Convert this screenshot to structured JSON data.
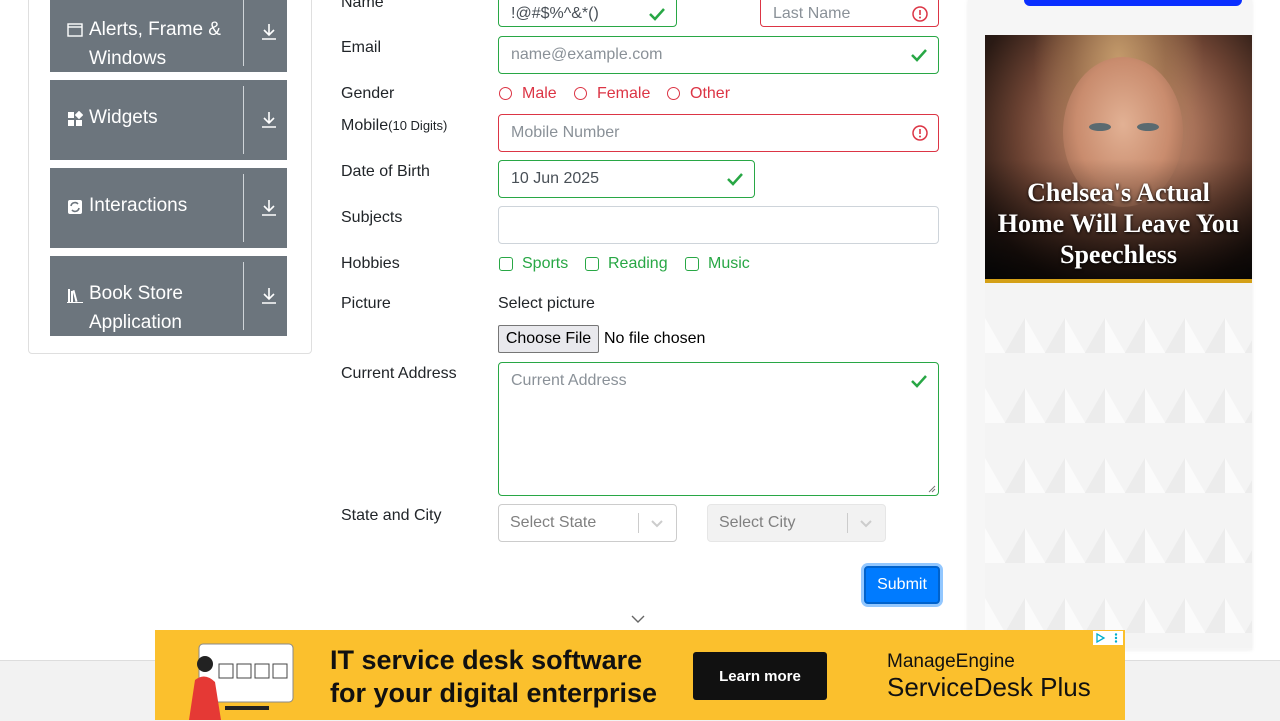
{
  "sidebar": {
    "groups": [
      {
        "label": "Alerts, Frame & Windows",
        "icon": "window-icon"
      },
      {
        "label": "Widgets",
        "icon": "widgets-icon"
      },
      {
        "label": "Interactions",
        "icon": "interactions-icon"
      },
      {
        "label": "Book Store Application",
        "icon": "books-icon"
      }
    ]
  },
  "form": {
    "name": {
      "label": "Name",
      "first_value": "!@#$%^&*()",
      "last_placeholder": "Last Name"
    },
    "email": {
      "label": "Email",
      "placeholder": "name@example.com"
    },
    "gender": {
      "label": "Gender",
      "options": [
        "Male",
        "Female",
        "Other"
      ]
    },
    "mobile": {
      "label": "Mobile",
      "hint": "(10 Digits)",
      "placeholder": "Mobile Number"
    },
    "dob": {
      "label": "Date of Birth",
      "value": "10 Jun 2025"
    },
    "subjects": {
      "label": "Subjects",
      "value": ""
    },
    "hobbies": {
      "label": "Hobbies",
      "options": [
        "Sports",
        "Reading",
        "Music"
      ]
    },
    "picture": {
      "label": "Picture",
      "select_text": "Select picture",
      "button": "Choose File",
      "status": "No file chosen"
    },
    "address": {
      "label": "Current Address",
      "placeholder": "Current Address"
    },
    "state_city": {
      "label": "State and City",
      "state_placeholder": "Select State",
      "city_placeholder": "Select City"
    },
    "submit": "Submit"
  },
  "ads": {
    "right": {
      "headline": "Chelsea's Actual Home Will Leave You Speechless"
    },
    "bottom": {
      "line1": "IT service desk software",
      "line2": "for your digital enterprise",
      "cta": "Learn more",
      "brand_top": "ManageEngine",
      "brand_bottom": "ServiceDesk Plus"
    }
  },
  "colors": {
    "valid": "#28a745",
    "invalid": "#dc3545",
    "primary": "#007bff",
    "sidebar": "#6c757d"
  }
}
